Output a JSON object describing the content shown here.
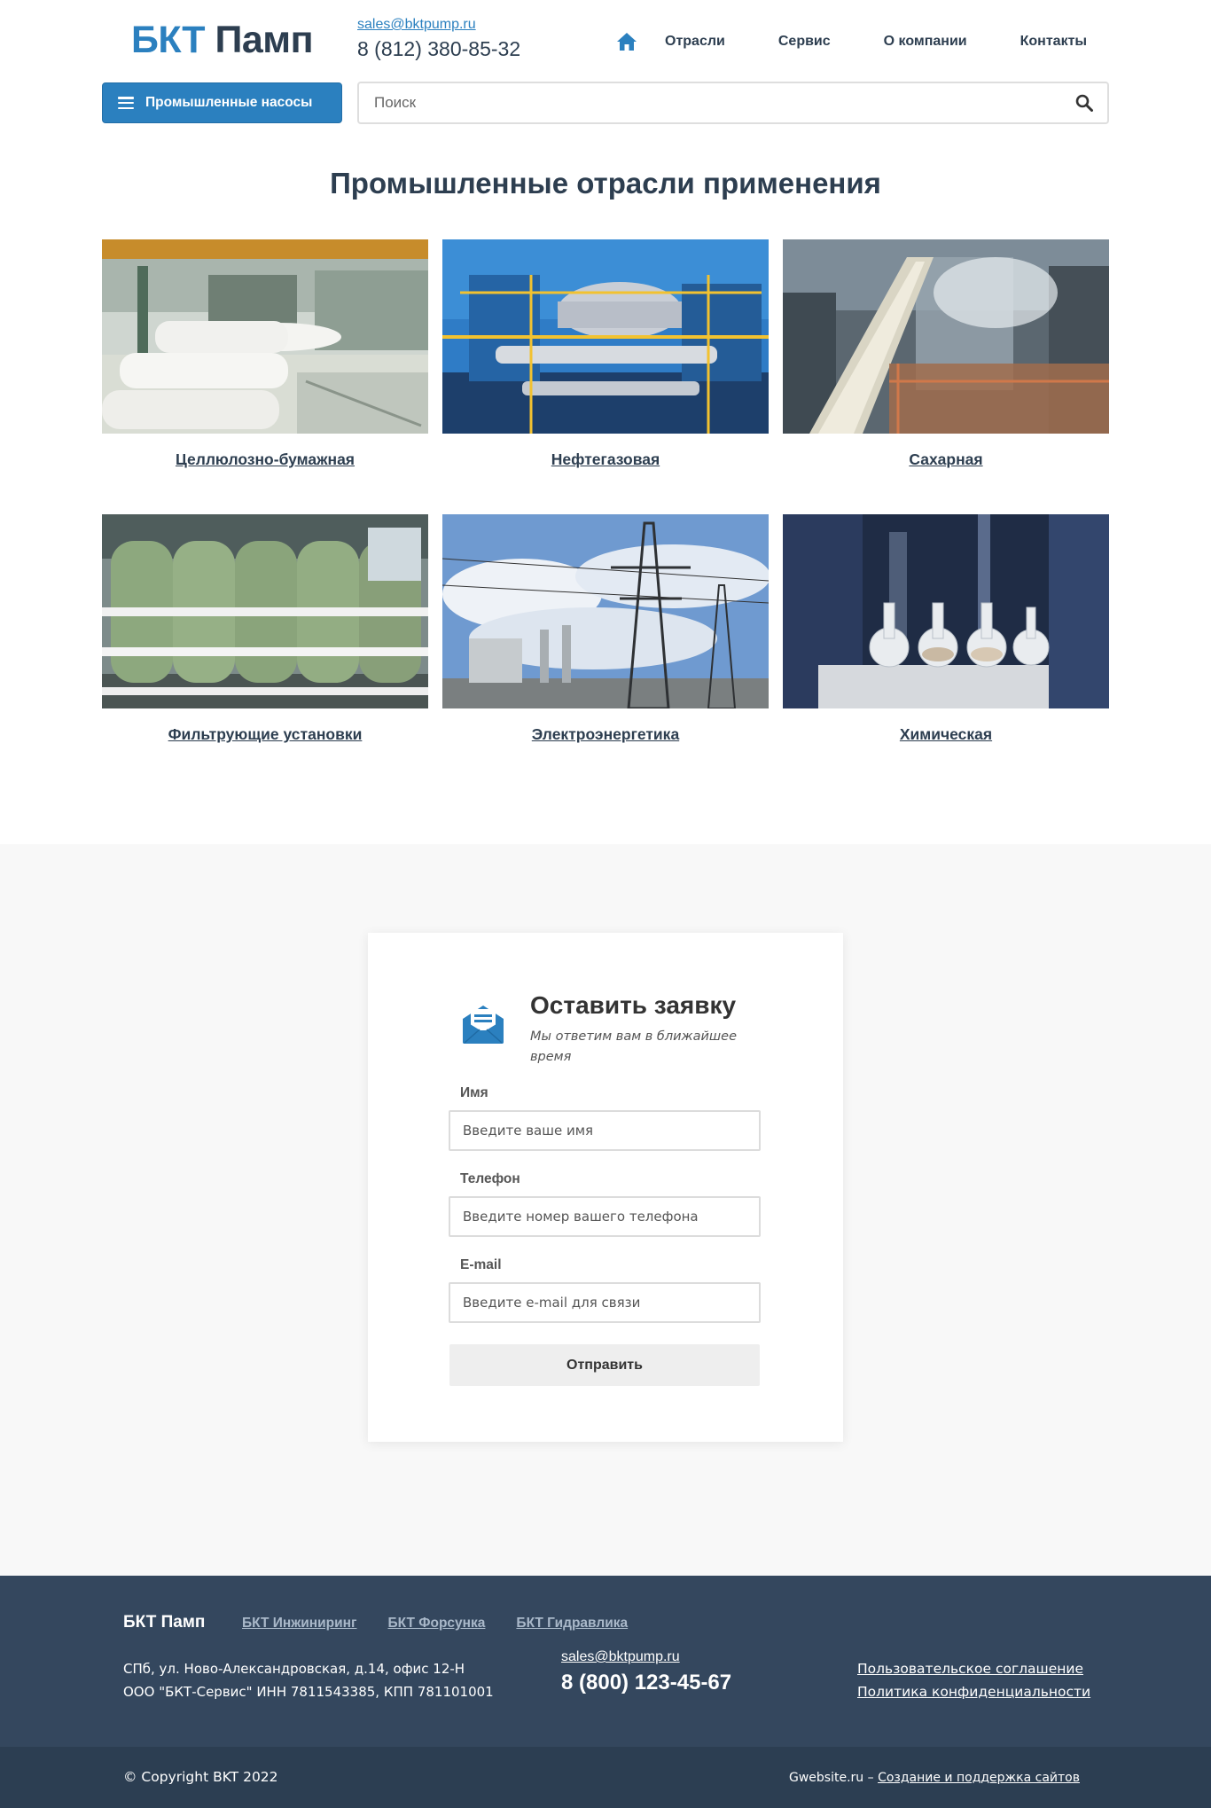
{
  "header": {
    "logo_part1": "БКТ",
    "logo_part2": "Памп",
    "email": "sales@bktpump.ru",
    "phone": "8 (812) 380-85-32",
    "nav": [
      "Отрасли",
      "Сервис",
      "О компании",
      "Контакты"
    ],
    "home_icon": "home-icon",
    "catalog_button": "Промышленные насосы",
    "search_placeholder": "Поиск",
    "search_icon": "search-icon"
  },
  "industries": {
    "title": "Промышленные отрасли применения",
    "items": [
      {
        "label": "Целлюлозно-бумажная"
      },
      {
        "label": "Нефтегазовая"
      },
      {
        "label": "Сахарная"
      },
      {
        "label": "Фильтрующие установки"
      },
      {
        "label": "Электроэнергетика"
      },
      {
        "label": "Химическая"
      }
    ]
  },
  "form": {
    "title": "Оставить заявку",
    "subtitle": "Мы ответим вам в ближайшее время",
    "icon": "envelope-icon",
    "fields": [
      {
        "label": "Имя",
        "placeholder": "Введите ваше имя"
      },
      {
        "label": "Телефон",
        "placeholder": "Введите номер вашего телефона"
      },
      {
        "label": "E-mail",
        "placeholder": "Введите e-mail для связи"
      }
    ],
    "submit": "Отправить"
  },
  "footer": {
    "brand": "БКТ Памп",
    "links": [
      "БКТ Инжиниринг",
      "БКТ Форсунка",
      "БКТ Гидравлика"
    ],
    "address_line1": "СПб, ул. Ново-Александровская, д.14, офис 12-Н",
    "address_line2": "ООО \"БКТ-Сервис\" ИНН 7811543385, КПП 781101001",
    "email": "sales@bktpump.ru",
    "phone": "8 (800) 123-45-67",
    "legal": [
      "Пользовательское соглашение",
      "Политика конфиденциальности"
    ],
    "copyright": "© Copyright BKT 2022",
    "developer_prefix": "Gwebsite.ru –",
    "developer_link": "Создание и поддержка сайтов"
  },
  "colors": {
    "brand_blue": "#2b80bf",
    "dark_navy": "#2d3e50",
    "footer_bg": "#34475e",
    "footer_bottom_bg": "#2c3e52",
    "form_bg": "#f8f8f8"
  }
}
